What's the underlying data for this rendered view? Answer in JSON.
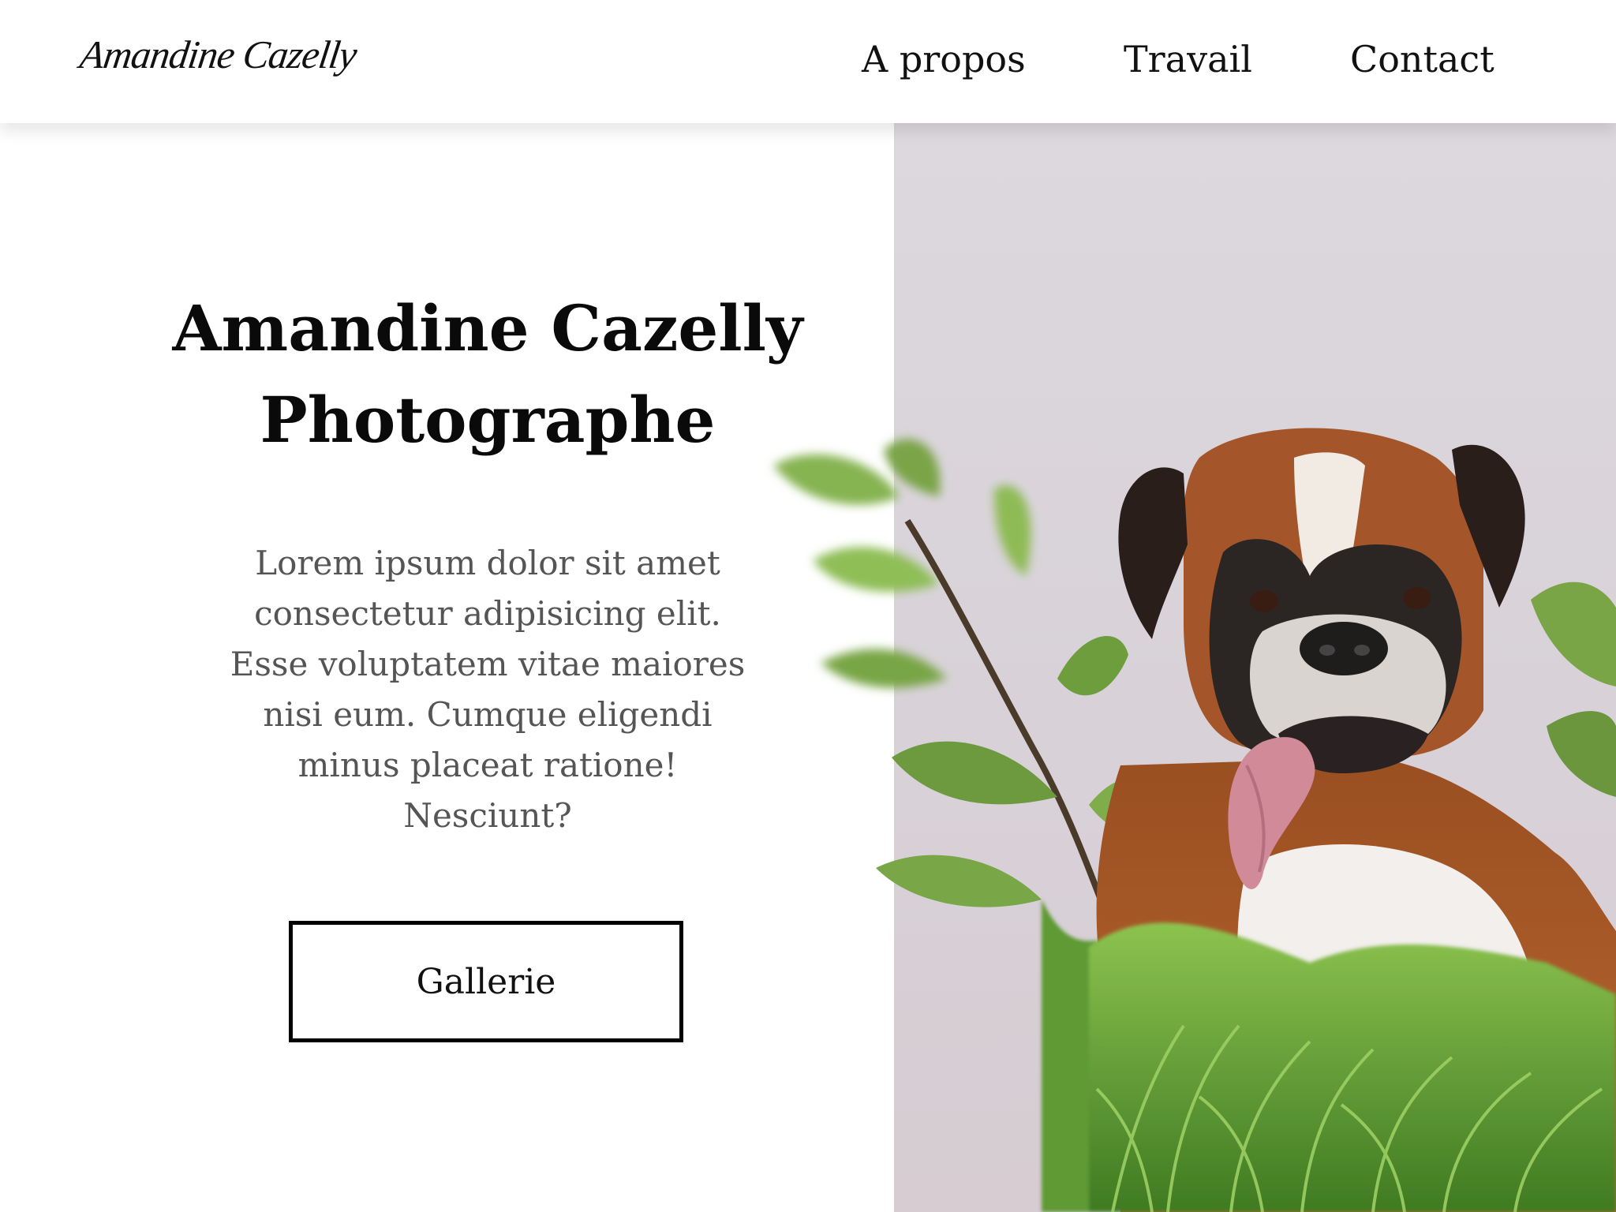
{
  "header": {
    "logo": "Amandine Cazelly",
    "nav": [
      {
        "label": "A propos"
      },
      {
        "label": "Travail"
      },
      {
        "label": "Contact"
      }
    ]
  },
  "hero": {
    "title_line1": "Amandine Cazelly",
    "title_line2": "Photographe",
    "text": "Lorem ipsum dolor sit amet consectetur adipisicing elit. Esse voluptatem vitae maiores nisi eum. Cumque eligendi minus placeat ratione! Nesciunt?",
    "button_label": "Gallerie"
  },
  "colors": {
    "panel": "#dad5da",
    "text_dark": "#0a0a0a",
    "text_muted": "#555555",
    "leaf": "#7aa54a",
    "dog_fur": "#a85a2a"
  }
}
